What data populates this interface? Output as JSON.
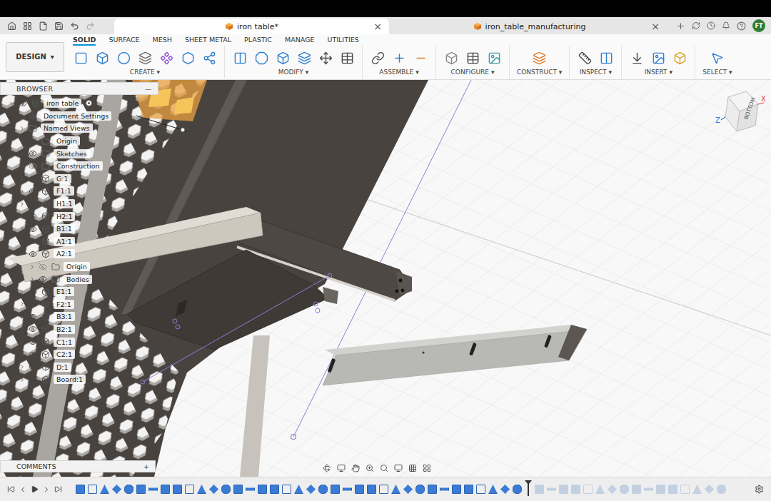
{
  "tabs": [
    {
      "title": "iron table*",
      "selected": true
    },
    {
      "title": "iron_table_manufacturing",
      "selected": false
    }
  ],
  "close": "×",
  "user": {
    "initials": "FT"
  },
  "workspace": {
    "label": "DESIGN",
    "caret": "▾"
  },
  "mode_tabs": [
    {
      "label": "SOLID",
      "selected": true
    },
    {
      "label": "SURFACE",
      "selected": false
    },
    {
      "label": "MESH",
      "selected": false
    },
    {
      "label": "SHEET METAL",
      "selected": false
    },
    {
      "label": "PLASTIC",
      "selected": false
    },
    {
      "label": "MANAGE",
      "selected": false
    },
    {
      "label": "UTILITIES",
      "selected": false
    }
  ],
  "tool_groups": [
    {
      "label": "CREATE"
    },
    {
      "label": "MODIFY"
    },
    {
      "label": "ASSEMBLE"
    },
    {
      "label": "CONFIGURE"
    },
    {
      "label": "CONSTRUCT"
    },
    {
      "label": "INSPECT"
    },
    {
      "label": "INSERT"
    },
    {
      "label": "SELECT"
    }
  ],
  "browser": {
    "title": "BROWSER",
    "collapse": "—",
    "items": [
      {
        "label": "iron table",
        "kind": "root",
        "depth": 0,
        "expanded": true,
        "visible": true,
        "active": true
      },
      {
        "label": "Document Settings",
        "kind": "settings",
        "depth": 1,
        "expanded": false
      },
      {
        "label": "Named Views",
        "kind": "folder",
        "depth": 1,
        "expanded": false
      },
      {
        "label": "Origin",
        "kind": "folder",
        "depth": 1,
        "expanded": false,
        "visible": true
      },
      {
        "label": "Sketches",
        "kind": "folder",
        "depth": 1,
        "expanded": false,
        "visible": true
      },
      {
        "label": "Construction",
        "kind": "folder",
        "depth": 1,
        "expanded": false,
        "visible": false
      },
      {
        "label": "G:1",
        "kind": "component",
        "depth": 1,
        "expanded": false,
        "visible": true
      },
      {
        "label": "F1:1",
        "kind": "component",
        "depth": 1,
        "expanded": false,
        "visible": true
      },
      {
        "label": "H1:1",
        "kind": "component",
        "depth": 1,
        "expanded": false,
        "visible": true
      },
      {
        "label": "H2:1",
        "kind": "component",
        "depth": 1,
        "expanded": false,
        "visible": true
      },
      {
        "label": "B1:1",
        "kind": "component",
        "depth": 1,
        "expanded": false,
        "visible": true
      },
      {
        "label": "A1:1",
        "kind": "component",
        "depth": 1,
        "expanded": false,
        "visible": true
      },
      {
        "label": "A2:1",
        "kind": "component",
        "depth": 1,
        "expanded": true,
        "visible": true
      },
      {
        "label": "Origin",
        "kind": "folder",
        "depth": 2,
        "expanded": false,
        "visible": false
      },
      {
        "label": "Bodies",
        "kind": "folder",
        "depth": 2,
        "expanded": false,
        "visible": true
      },
      {
        "label": "E1:1",
        "kind": "component",
        "depth": 1,
        "expanded": false,
        "visible": true
      },
      {
        "label": "F2:1",
        "kind": "component",
        "depth": 1,
        "expanded": false,
        "visible": true
      },
      {
        "label": "B3:1",
        "kind": "component",
        "depth": 1,
        "expanded": false,
        "visible": true
      },
      {
        "label": "B2:1",
        "kind": "component",
        "depth": 1,
        "expanded": false,
        "visible": true
      },
      {
        "label": "C1:1",
        "kind": "component",
        "depth": 1,
        "expanded": false,
        "visible": true
      },
      {
        "label": "C2:1",
        "kind": "component",
        "depth": 1,
        "expanded": false,
        "visible": true
      },
      {
        "label": "D:1",
        "kind": "component",
        "depth": 1,
        "expanded": false,
        "visible": true
      },
      {
        "label": "Board:1",
        "kind": "component",
        "depth": 1,
        "expanded": false,
        "visible": true
      }
    ]
  },
  "viewcube": {
    "face": "BOTTOM",
    "axes": [
      {
        "label": "X",
        "color": "#e0443c"
      },
      {
        "label": "Z",
        "color": "#3b6fd8"
      }
    ]
  },
  "comments": {
    "title": "COMMENTS",
    "add": "+"
  },
  "timeline": {
    "features_before_marker": 37,
    "features_after_marker": 16
  }
}
